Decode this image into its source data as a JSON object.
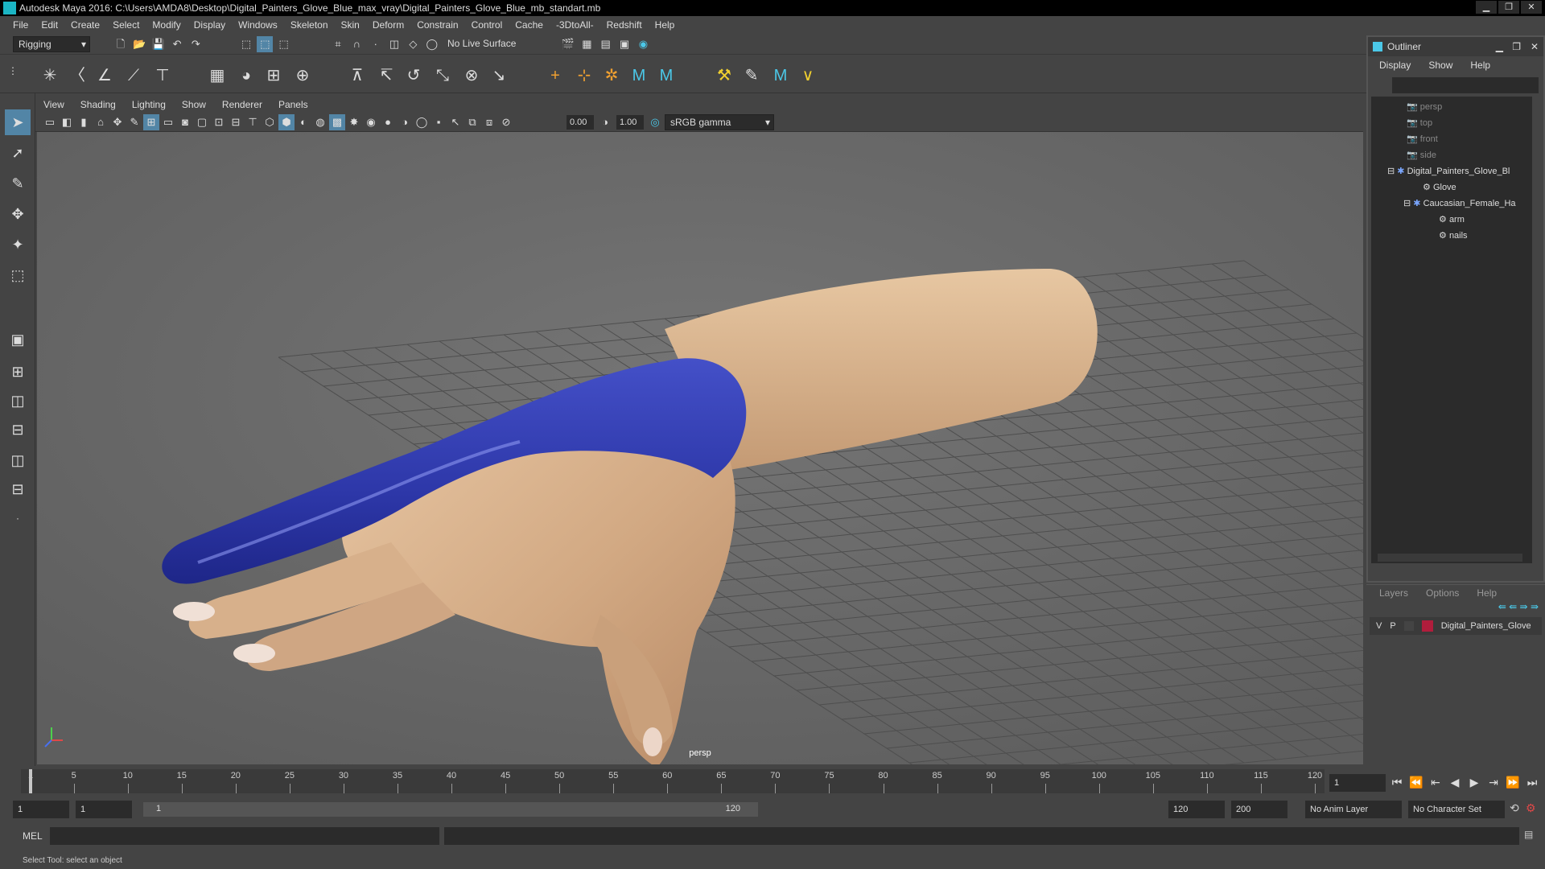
{
  "title": "Autodesk Maya 2016: C:\\Users\\AMDA8\\Desktop\\Digital_Painters_Glove_Blue_max_vray\\Digital_Painters_Glove_Blue_mb_standart.mb",
  "window_controls": [
    "▁",
    "❐",
    "✕"
  ],
  "menu": [
    "File",
    "Edit",
    "Create",
    "Select",
    "Modify",
    "Display",
    "Windows",
    "Skeleton",
    "Skin",
    "Deform",
    "Constrain",
    "Control",
    "Cache",
    "-3DtoAll-",
    "Redshift",
    "Help"
  ],
  "statusline": {
    "menuset": "Rigging",
    "live_surface": "No Live Surface"
  },
  "panel": {
    "menu": [
      "View",
      "Shading",
      "Lighting",
      "Show",
      "Renderer",
      "Panels"
    ],
    "field1": "0.00",
    "field2": "1.00",
    "color_space": "sRGB gamma",
    "camera": "persp"
  },
  "outliner": {
    "title": "Outliner",
    "menu": [
      "Display",
      "Show",
      "Help"
    ],
    "items": [
      {
        "label": "persp",
        "dim": true
      },
      {
        "label": "top",
        "dim": true
      },
      {
        "label": "front",
        "dim": true
      },
      {
        "label": "side",
        "dim": true
      },
      {
        "label": "Digital_Painters_Glove_Bl",
        "dim": false
      },
      {
        "label": "Glove",
        "dim": false
      },
      {
        "label": "Caucasian_Female_Ha",
        "dim": false
      },
      {
        "label": "arm",
        "dim": false
      },
      {
        "label": "nails",
        "dim": false
      }
    ]
  },
  "layers": {
    "menu": [
      "Layers",
      "Options",
      "Help"
    ],
    "row": {
      "v": "V",
      "p": "P",
      "name": "Digital_Painters_Glove",
      "color": "#b01d3c"
    }
  },
  "timeline": {
    "ticks": [
      1,
      5,
      10,
      15,
      20,
      25,
      30,
      35,
      40,
      45,
      50,
      55,
      60,
      65,
      70,
      75,
      80,
      85,
      90,
      95,
      100,
      105,
      110,
      115,
      120
    ],
    "current_frame": "1"
  },
  "range": {
    "start": "1",
    "playback_start": "1",
    "slider_start": "1",
    "slider_end": "120",
    "playback_end": "120",
    "end": "200",
    "anim_layer": "No Anim Layer",
    "character_set": "No Character Set"
  },
  "cmdline": {
    "label": "MEL"
  },
  "helpline": "Select Tool: select an object"
}
